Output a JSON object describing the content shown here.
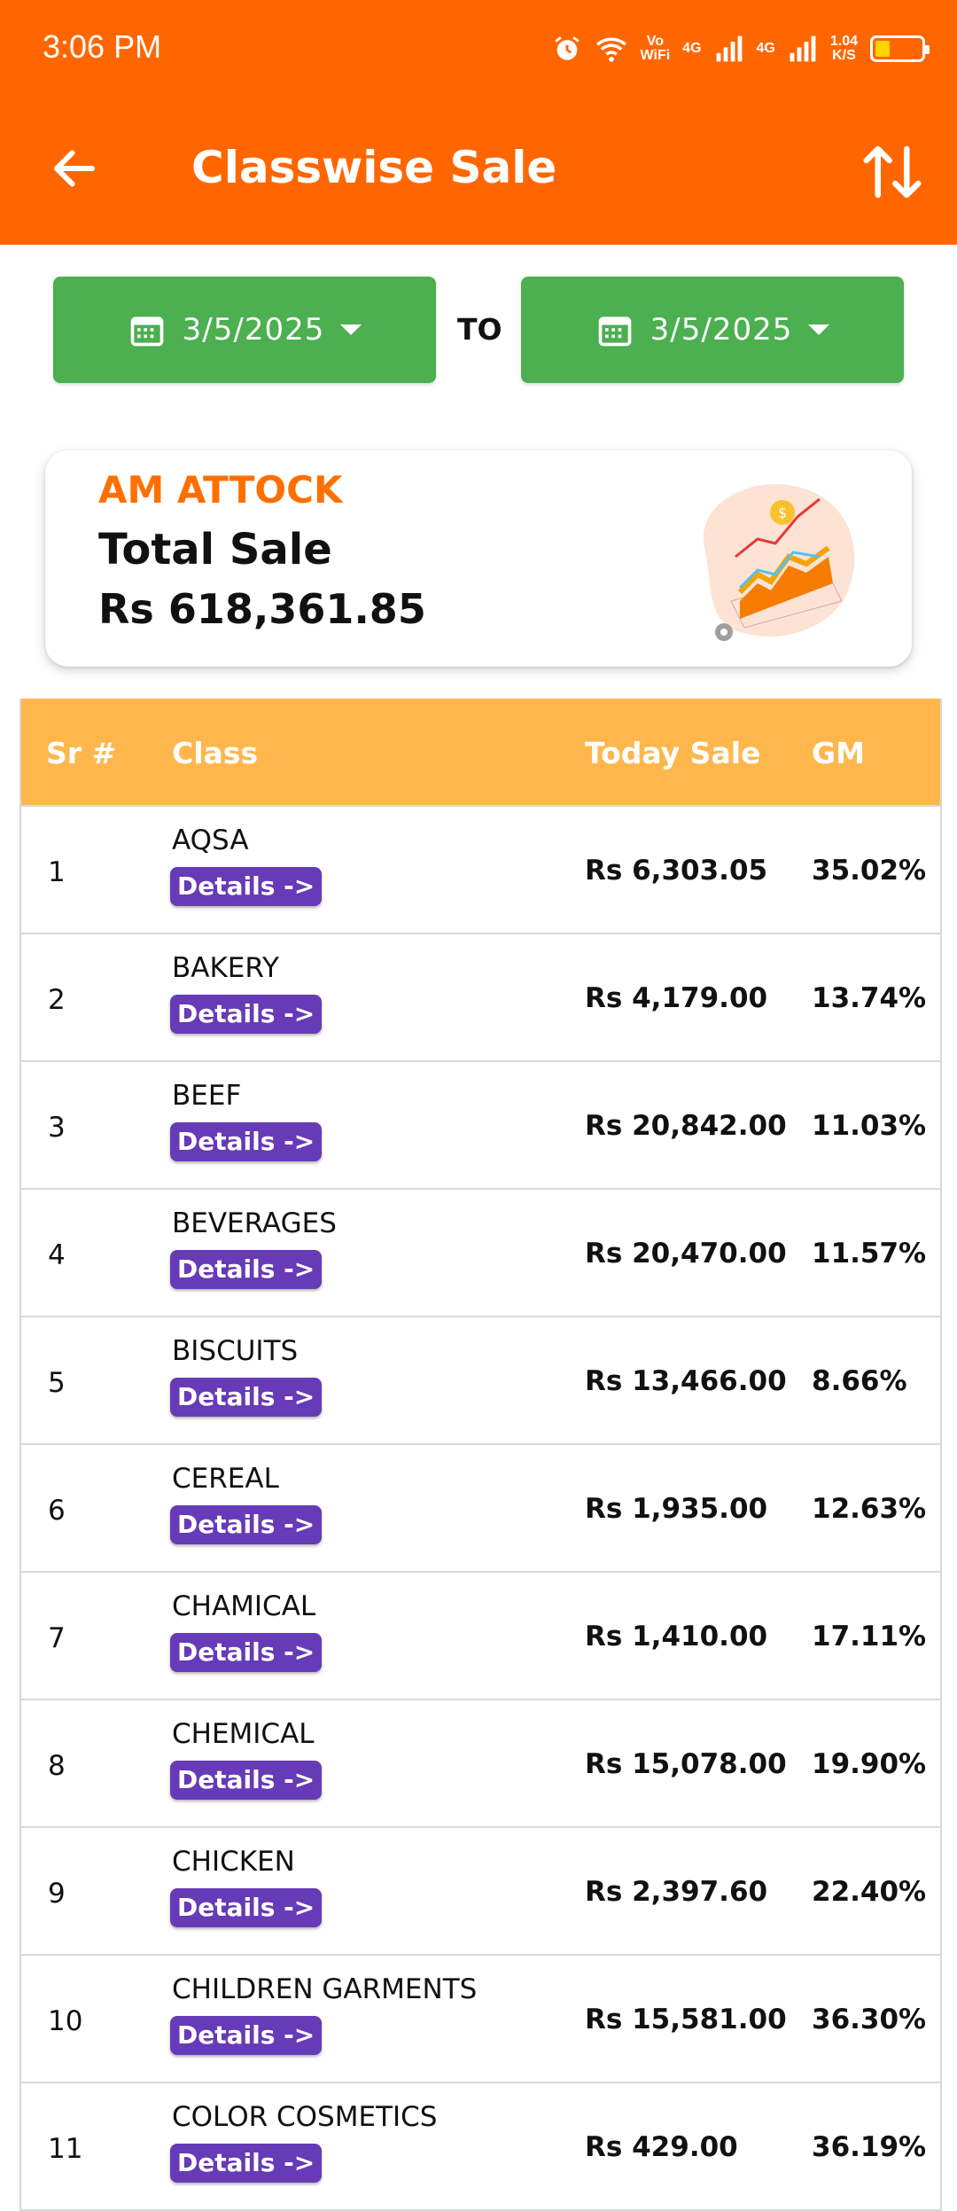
{
  "status_bar": {
    "time": "3:06 PM",
    "volte": "Vo\nWiFi",
    "net1": "4G",
    "net2": "4G",
    "speed": "1.04\nK/S"
  },
  "header": {
    "title": "Classwise Sale",
    "back_icon": "arrow-left-icon",
    "sort_icon": "sort-arrows-icon",
    "color": "#ff6600"
  },
  "date_range": {
    "from": "3/5/2025",
    "to_label": "TO",
    "to": "3/5/2025",
    "button_color": "#4caf50"
  },
  "summary": {
    "branch": "AM ATTOCK",
    "label": "Total Sale",
    "amount": "Rs 618,361.85"
  },
  "table": {
    "headers": {
      "sr": "Sr #",
      "class": "Class",
      "sale": "Today Sale",
      "gm": "GM"
    },
    "header_color": "#ffb74d",
    "details_label": "Details ->",
    "details_color": "#673ab7",
    "rows": [
      {
        "sr": "1",
        "class": "AQSA",
        "sale": "Rs 6,303.05",
        "gm": "35.02%"
      },
      {
        "sr": "2",
        "class": "BAKERY",
        "sale": "Rs 4,179.00",
        "gm": "13.74%"
      },
      {
        "sr": "3",
        "class": "BEEF",
        "sale": "Rs 20,842.00",
        "gm": "11.03%"
      },
      {
        "sr": "4",
        "class": "BEVERAGES",
        "sale": "Rs 20,470.00",
        "gm": "11.57%"
      },
      {
        "sr": "5",
        "class": "BISCUITS",
        "sale": "Rs 13,466.00",
        "gm": "8.66%"
      },
      {
        "sr": "6",
        "class": "CEREAL",
        "sale": "Rs 1,935.00",
        "gm": "12.63%"
      },
      {
        "sr": "7",
        "class": "CHAMICAL",
        "sale": "Rs 1,410.00",
        "gm": "17.11%"
      },
      {
        "sr": "8",
        "class": "CHEMICAL",
        "sale": "Rs 15,078.00",
        "gm": "19.90%"
      },
      {
        "sr": "9",
        "class": "CHICKEN",
        "sale": "Rs 2,397.60",
        "gm": "22.40%"
      },
      {
        "sr": "10",
        "class": "CHILDREN GARMENTS",
        "sale": "Rs 15,581.00",
        "gm": "36.30%"
      },
      {
        "sr": "11",
        "class": "COLOR COSMETICS",
        "sale": "Rs 429.00",
        "gm": "36.19%"
      }
    ]
  }
}
